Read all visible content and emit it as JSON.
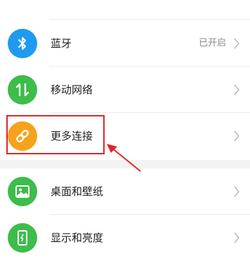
{
  "settings": {
    "items": [
      {
        "label": "蓝牙",
        "value": "已开启",
        "icon": "bluetooth-icon",
        "icon_color": "#1e9bf0"
      },
      {
        "label": "移动网络",
        "value": "",
        "icon": "mobile-data-icon",
        "icon_color": "#3dbd4a"
      },
      {
        "label": "更多连接",
        "value": "",
        "icon": "link-icon",
        "icon_color": "#f7a21c"
      },
      {
        "label": "桌面和壁纸",
        "value": "",
        "icon": "wallpaper-icon",
        "icon_color": "#3dbd4a"
      },
      {
        "label": "显示和亮度",
        "value": "",
        "icon": "display-brightness-icon",
        "icon_color": "#3dbd4a"
      }
    ]
  },
  "annotation": {
    "color": "#e0262b",
    "target": "更多连接"
  }
}
